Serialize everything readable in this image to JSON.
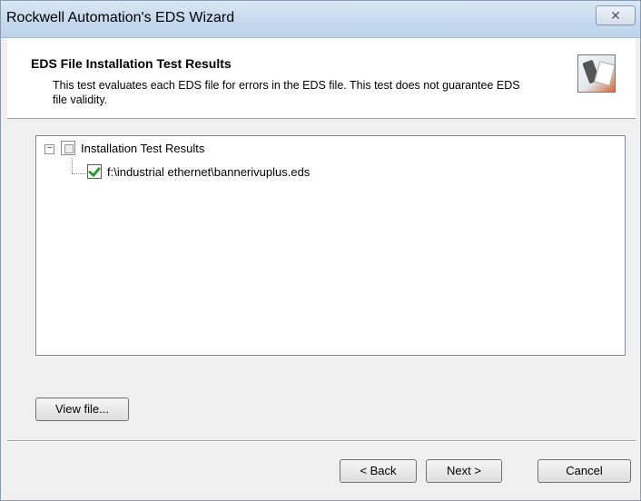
{
  "window": {
    "title": "Rockwell Automation's EDS Wizard",
    "close_label": "✕"
  },
  "header": {
    "title": "EDS File Installation Test Results",
    "description": "This test evaluates each EDS file for errors in the EDS file. This test does not guarantee EDS file validity.",
    "image_icon": "wizard-graphic-icon"
  },
  "tree": {
    "root": {
      "label": "Installation Test Results",
      "expander": "−",
      "icon": "results-folder-icon"
    },
    "children": [
      {
        "label": "f:\\industrial ethernet\\bannerivuplus.eds",
        "icon": "green-check-icon"
      }
    ]
  },
  "buttons": {
    "view_file": "View file...",
    "back": "< Back",
    "next": "Next >",
    "cancel": "Cancel"
  }
}
